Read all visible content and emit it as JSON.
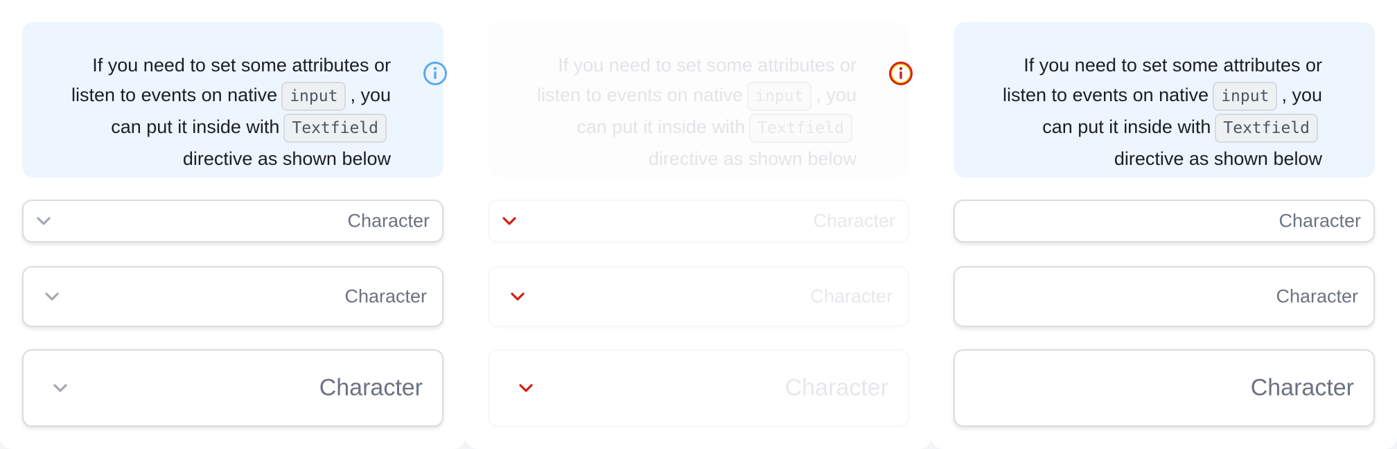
{
  "panels": [
    {
      "notice": {
        "text_before_input": "If you need to set some attributes or",
        "line2_prefix": "listen to events on native",
        "input_code": "input",
        "line2_suffix": ", you",
        "line3_prefix": "can put it inside with",
        "textfield_code": "Textfield",
        "line4": "directive as shown below",
        "icon": "info-icon"
      },
      "fields": [
        {
          "label": "Character",
          "icon": "chevron-down-icon"
        },
        {
          "label": "Character",
          "icon": "chevron-down-icon"
        },
        {
          "label": "Character",
          "icon": "chevron-down-icon"
        }
      ]
    },
    {
      "notice": {
        "text_before_input": "If you need to set some attributes or",
        "line2_prefix": "listen to events on native",
        "input_code": "input",
        "line2_suffix": ", you",
        "line3_prefix": "can put it inside with",
        "textfield_code": "Textfield",
        "line4": "directive as shown below",
        "icon": "info-icon"
      },
      "fields": [
        {
          "label": "Character",
          "icon": "chevron-down-icon"
        },
        {
          "label": "Character",
          "icon": "chevron-down-icon"
        },
        {
          "label": "Character",
          "icon": "chevron-down-icon"
        }
      ]
    },
    {
      "notice": {
        "text_before_input": "If you need to set some attributes or",
        "line2_prefix": "listen to events on native",
        "input_code": "input",
        "line2_suffix": ", you",
        "line3_prefix": "can put it inside with",
        "textfield_code": "Textfield",
        "line4": "directive as shown below"
      },
      "fields": [
        {
          "label": "Character"
        },
        {
          "label": "Character"
        },
        {
          "label": "Character"
        }
      ]
    }
  ],
  "colors": {
    "info_blue": "#5aa9f0",
    "info_red": "#d21f11",
    "info_yellow": "#f4c200",
    "chevron_gray": "#a3a8b1",
    "chevron_red": "#d21f11",
    "notice_bg": "#edf5fe"
  }
}
